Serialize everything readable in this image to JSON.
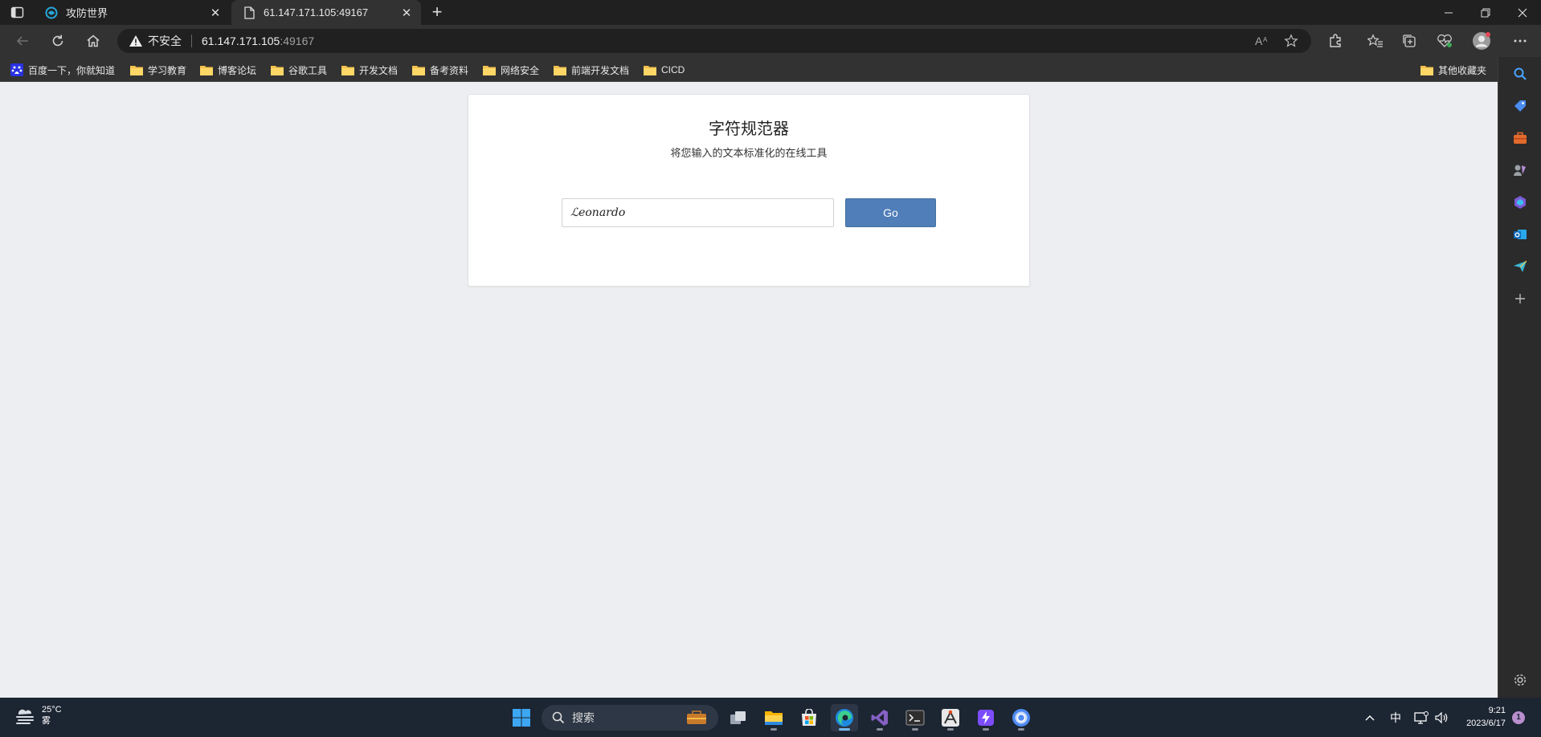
{
  "browser": {
    "tabs": [
      {
        "title": "攻防世界",
        "icon": "adworld-favicon"
      },
      {
        "title": "61.147.171.105:49167",
        "icon": "page-icon"
      }
    ],
    "address_bar": {
      "security_label": "不安全",
      "host": "61.147.171.105",
      "port": ":49167"
    },
    "bookmarks": [
      {
        "label": "百度一下，你就知道",
        "icon": "baidu-icon"
      },
      {
        "label": "学习教育",
        "icon": "folder-icon"
      },
      {
        "label": "博客论坛",
        "icon": "folder-icon"
      },
      {
        "label": "谷歌工具",
        "icon": "folder-icon"
      },
      {
        "label": "开发文档",
        "icon": "folder-icon"
      },
      {
        "label": "备考资料",
        "icon": "folder-icon"
      },
      {
        "label": "网络安全",
        "icon": "folder-icon"
      },
      {
        "label": "前端开发文档",
        "icon": "folder-icon"
      },
      {
        "label": "CICD",
        "icon": "folder-icon"
      }
    ],
    "other_bookmarks": "其他收藏夹"
  },
  "page": {
    "title": "字符规范器",
    "subtitle": "将您输入的文本标准化的在线工具",
    "input_value": "ℒ𝑒𝑜𝑛𝑎𝑟𝑑𝑜",
    "go_label": "Go"
  },
  "taskbar": {
    "weather": {
      "temp": "25°C",
      "condition": "雾"
    },
    "search_label": "搜索",
    "ime": "中",
    "time": "9:21",
    "date": "2023/6/17",
    "notifications": "1"
  },
  "colors": {
    "accent_button": "#4f7eb8",
    "page_background": "#eceef1",
    "browser_chrome": "#323232"
  }
}
